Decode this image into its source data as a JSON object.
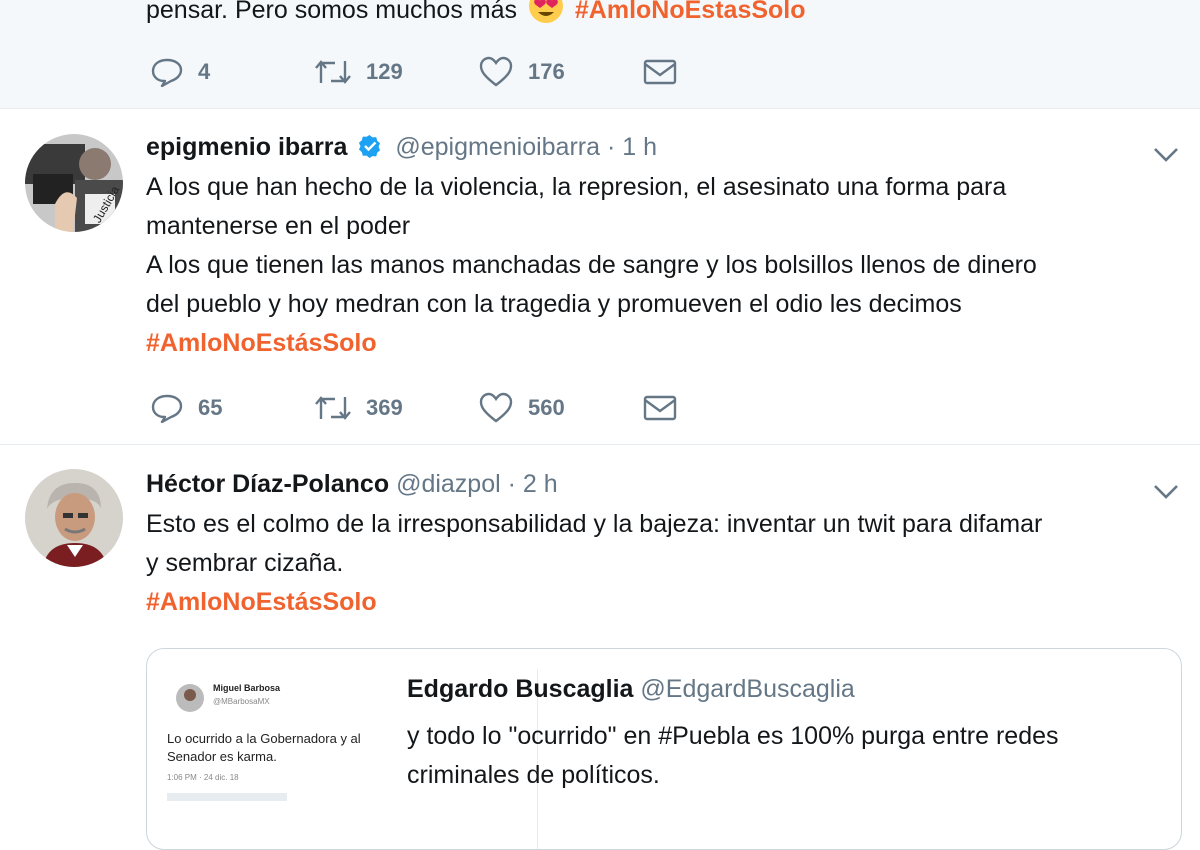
{
  "tweets": [
    {
      "text_line_1": "pensar. Pero somos muchos más",
      "emoji": "heart-eyes-emoji",
      "hashtag": "#AmloNoEstasSolo",
      "replies": "4",
      "retweets": "129",
      "likes": "176"
    },
    {
      "name": "epigmenio ibarra",
      "handle": "@epigmenioibarra",
      "separator": "·",
      "time": "1 h",
      "lines": [
        "A los que han hecho de la violencia, la represion, el asesinato una forma para",
        "mantenerse en el poder",
        "A los que tienen las manos manchadas de sangre y los bolsillos llenos de dinero",
        "del pueblo y hoy medran con la tragedia y promueven el odio les decimos"
      ],
      "hashtag": "#AmloNoEstásSolo",
      "replies": "65",
      "retweets": "369",
      "likes": "560"
    },
    {
      "name": "Héctor Díaz-Polanco",
      "handle": "@diazpol",
      "separator": "·",
      "time": "2 h",
      "lines": [
        "Esto es el colmo de la irresponsabilidad y la bajeza: inventar un twit para difamar",
        "y sembrar cizaña."
      ],
      "hashtag": "#AmloNoEstásSolo",
      "quote": {
        "name": "Edgardo Buscaglia",
        "handle": "@EdgardBuscaglia",
        "lines": [
          "y todo lo \"ocurrido\" en #Puebla es 100% purga entre redes",
          "criminales de políticos."
        ],
        "image": {
          "name": "Miguel Barbosa",
          "handle": "@MBarbosaMX",
          "lines": [
            "Lo ocurrido a la Gobernadora y al",
            "Senador es karma."
          ],
          "meta": "1:06 PM · 24 dic. 18"
        }
      }
    }
  ],
  "colors": {
    "hashtag": "#f0632f",
    "verified": "#1da1f2",
    "muted": "#657786",
    "border": "#e6ecf0"
  }
}
